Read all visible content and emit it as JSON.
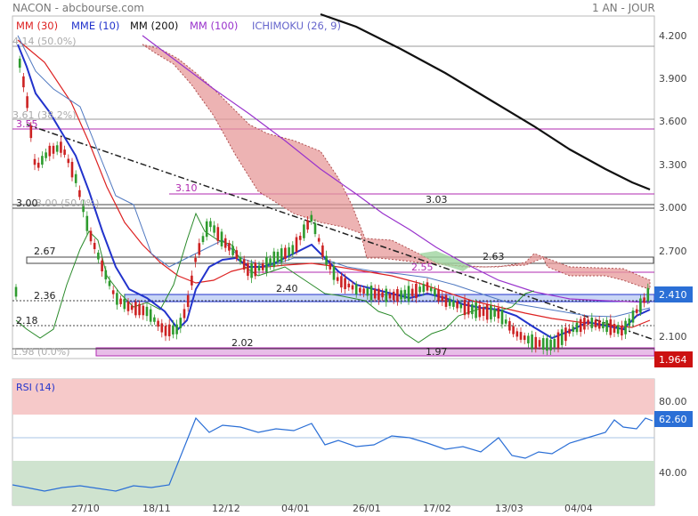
{
  "header": {
    "source": "NACON - abcbourse.com",
    "period": "1 AN - JOUR"
  },
  "legend": [
    {
      "label": "MM (30)",
      "color": "#dd2222"
    },
    {
      "label": "MME (10)",
      "color": "#2233cc"
    },
    {
      "label": "MM (200)",
      "color": "#111111"
    },
    {
      "label": "MM (100)",
      "color": "#9933cc"
    },
    {
      "label": "ICHIMOKU (26, 9)",
      "color": "#6666cc"
    }
  ],
  "chart_data": [
    {
      "type": "candlestick",
      "title": "NACON",
      "x_tick_labels": [
        "27/10",
        "18/11",
        "12/12",
        "04/01",
        "26/01",
        "17/02",
        "13/03",
        "04/04"
      ],
      "y_tick_labels": [
        "4.200",
        "3.900",
        "3.600",
        "3.300",
        "3.000",
        "2.700",
        "2.400",
        "2.100"
      ],
      "ylim": [
        1.9,
        4.3
      ],
      "last_price": "2.410",
      "low_marker": "1.964",
      "fibonacci_levels": [
        "4.14 (50.0%)",
        "3.61 (38.2%)",
        "3.00 (50.0%)",
        "1.98 (0.0%)"
      ],
      "level_labels": [
        "3.55",
        "3.10",
        "3.03",
        "3.00",
        "2.67",
        "2.63",
        "2.55",
        "2.40",
        "2.36",
        "2.18",
        "2.02",
        "1.97"
      ]
    },
    {
      "type": "line",
      "title": "RSI (14)",
      "y_tick_labels": [
        "80.00",
        "40.00"
      ],
      "ylim": [
        0,
        100
      ],
      "last_value": "62.60",
      "zones": {
        "overbought": 70,
        "oversold": 30
      }
    }
  ]
}
